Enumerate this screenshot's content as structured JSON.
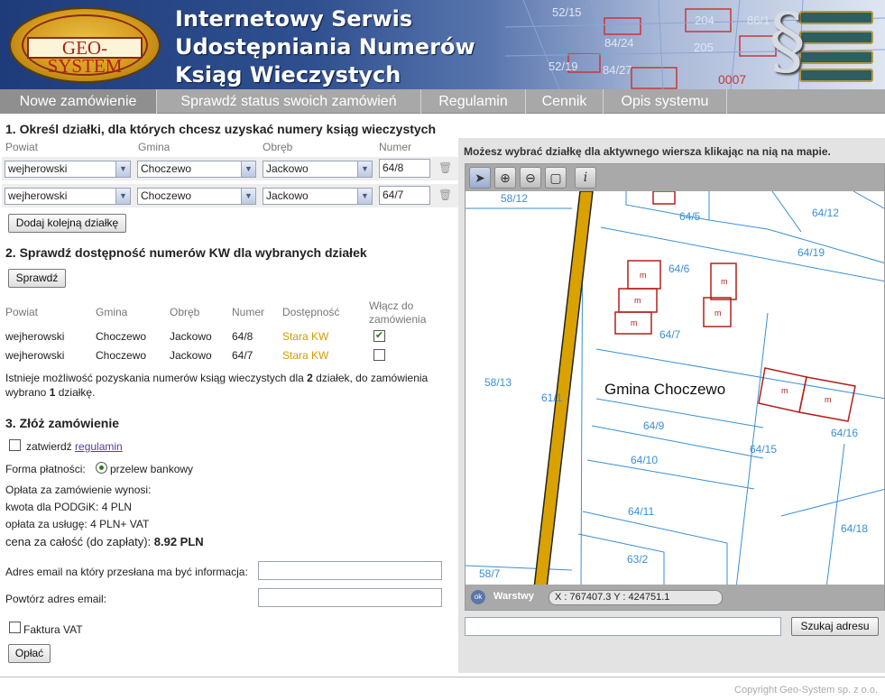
{
  "header": {
    "logo_text": "GEO-SYSTEM",
    "title_lines": [
      "Internetowy Serwis",
      "Udostępniania Numerów",
      "Ksiąg Wieczystych"
    ],
    "map_labels": [
      "52/15",
      "204",
      "86/1",
      "84/24",
      "205",
      "52/19",
      "84/27",
      "0007"
    ],
    "emblem_icon": "paragraph-icon"
  },
  "nav": {
    "tabs": [
      {
        "label": "Nowe zamówienie",
        "active": true
      },
      {
        "label": "Sprawdź status swoich zamówień",
        "active": false
      },
      {
        "label": "Regulamin",
        "active": false
      },
      {
        "label": "Cennik",
        "active": false
      },
      {
        "label": "Opis systemu",
        "active": false
      }
    ]
  },
  "step1": {
    "heading": "1. Określ działki, dla których chcesz uzyskać numery ksiąg wieczystych",
    "col_headers": [
      "Powiat",
      "Gmina",
      "Obręb",
      "Numer"
    ],
    "rows": [
      {
        "powiat": "wejherowski",
        "gmina": "Choczewo",
        "obreb": "Jackowo",
        "numer": "64/8"
      },
      {
        "powiat": "wejherowski",
        "gmina": "Choczewo",
        "obreb": "Jackowo",
        "numer": "64/7"
      }
    ],
    "add_button": "Dodaj kolejną działkę"
  },
  "step2": {
    "heading": "2. Sprawdź dostępność numerów KW dla wybranych działek",
    "check_button": "Sprawdź",
    "headers": [
      "Powiat",
      "Gmina",
      "Obręb",
      "Numer",
      "Dostępność",
      "Włącz do zamówienia"
    ],
    "rows": [
      {
        "powiat": "wejherowski",
        "gmina": "Choczewo",
        "obreb": "Jackowo",
        "numer": "64/8",
        "dostepnosc": "Stara KW",
        "included": true
      },
      {
        "powiat": "wejherowski",
        "gmina": "Choczewo",
        "obreb": "Jackowo",
        "numer": "64/7",
        "dostepnosc": "Stara KW",
        "included": false
      }
    ],
    "summary_prefix": "Istnieje możliwość pozyskania numerów ksiąg wieczystych dla ",
    "summary_count": "2",
    "summary_mid": " działek, do zamówienia wybrano ",
    "summary_selected": "1",
    "summary_suffix": " działkę."
  },
  "step3": {
    "heading": "3. Złóż zamówienie",
    "accept_prefix": "zatwierdź ",
    "accept_link": "regulamin",
    "accepted": false,
    "payment_label": "Forma płatności:",
    "payment_option": "przelew bankowy",
    "fee_intro": "Opłata za zamówienie wynosi:",
    "fee_podgik": "kwota dla PODGiK: 4 PLN",
    "fee_service": "opłata za usługę: 4 PLN+ VAT",
    "total_label": "cena za całość (do zapłaty): ",
    "total_value": "8.92 PLN",
    "email_label": "Adres email na który przesłana ma być informacja:",
    "email_value": "",
    "email_repeat_label": "Powtórz adres email:",
    "email_repeat_value": "",
    "invoice_label": "Faktura VAT",
    "invoice_checked": false,
    "pay_button": "Opłać"
  },
  "map": {
    "hint": "Możesz wybrać działkę dla aktywnego wiersza klikając na nią na mapie.",
    "tools": [
      "pointer-icon",
      "zoom-in-icon",
      "zoom-out-icon",
      "zoom-extent-icon",
      "info-icon"
    ],
    "gmina_label": "Gmina Choczewo",
    "parcel_labels": [
      "58/12",
      "64/5",
      "64/12",
      "64/19",
      "64/6",
      "64/7",
      "58/13",
      "61/1",
      "64/9",
      "64/16",
      "64/15",
      "64/10",
      "64/11",
      "64/18",
      "63/2",
      "58/7"
    ],
    "building_glyph": "m",
    "layers_label": "Warstwy",
    "ok_label": "ok",
    "coords": "X : 767407.3  Y : 424751.1",
    "address_value": "",
    "address_button": "Szukaj adresu"
  },
  "footer": {
    "copyright": "Copyright Geo-System sp. z o.o."
  }
}
